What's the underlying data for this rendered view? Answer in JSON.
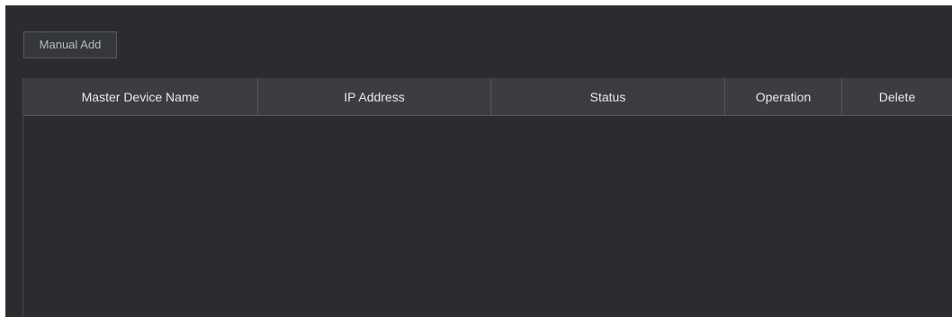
{
  "toolbar": {
    "manual_add_label": "Manual Add"
  },
  "table": {
    "columns": [
      "Master Device Name",
      "IP Address",
      "Status",
      "Operation",
      "Delete"
    ],
    "rows": []
  },
  "colors": {
    "panel_background": "#2b2c30",
    "header_background": "#3b3d42",
    "header_text": "#e8e9eb",
    "button_text": "#b7bac0"
  }
}
